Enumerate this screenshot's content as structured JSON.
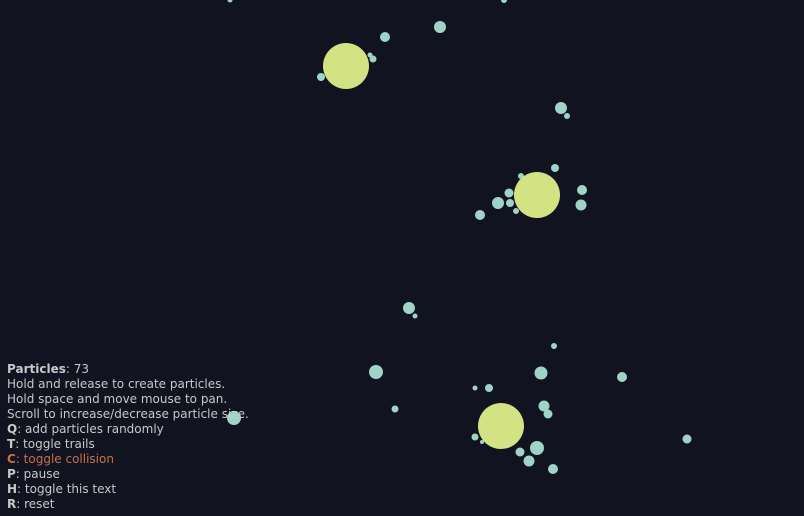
{
  "colors": {
    "background": "#111320",
    "particle": "#9fd3c7",
    "attractor": "#d3e384",
    "text": "#c8c8c8",
    "text_active": "#c8704a"
  },
  "hud": {
    "particles_label": "Particles",
    "particles_sep": ": ",
    "particles_count": "73",
    "line_create": "Hold and release to create particles.",
    "line_pan": "Hold space and move mouse to pan.",
    "line_scroll": "Scroll to increase/decrease particle size.",
    "keys": [
      {
        "key": "Q",
        "desc": ": add particles randomly",
        "active": false
      },
      {
        "key": "T",
        "desc": ": toggle trails",
        "active": false
      },
      {
        "key": "C",
        "desc": ": toggle collision",
        "active": true
      },
      {
        "key": "P",
        "desc": ": pause",
        "active": false
      },
      {
        "key": "H",
        "desc": ": toggle this text",
        "active": false
      },
      {
        "key": "R",
        "desc": ": reset",
        "active": false
      }
    ]
  }
}
